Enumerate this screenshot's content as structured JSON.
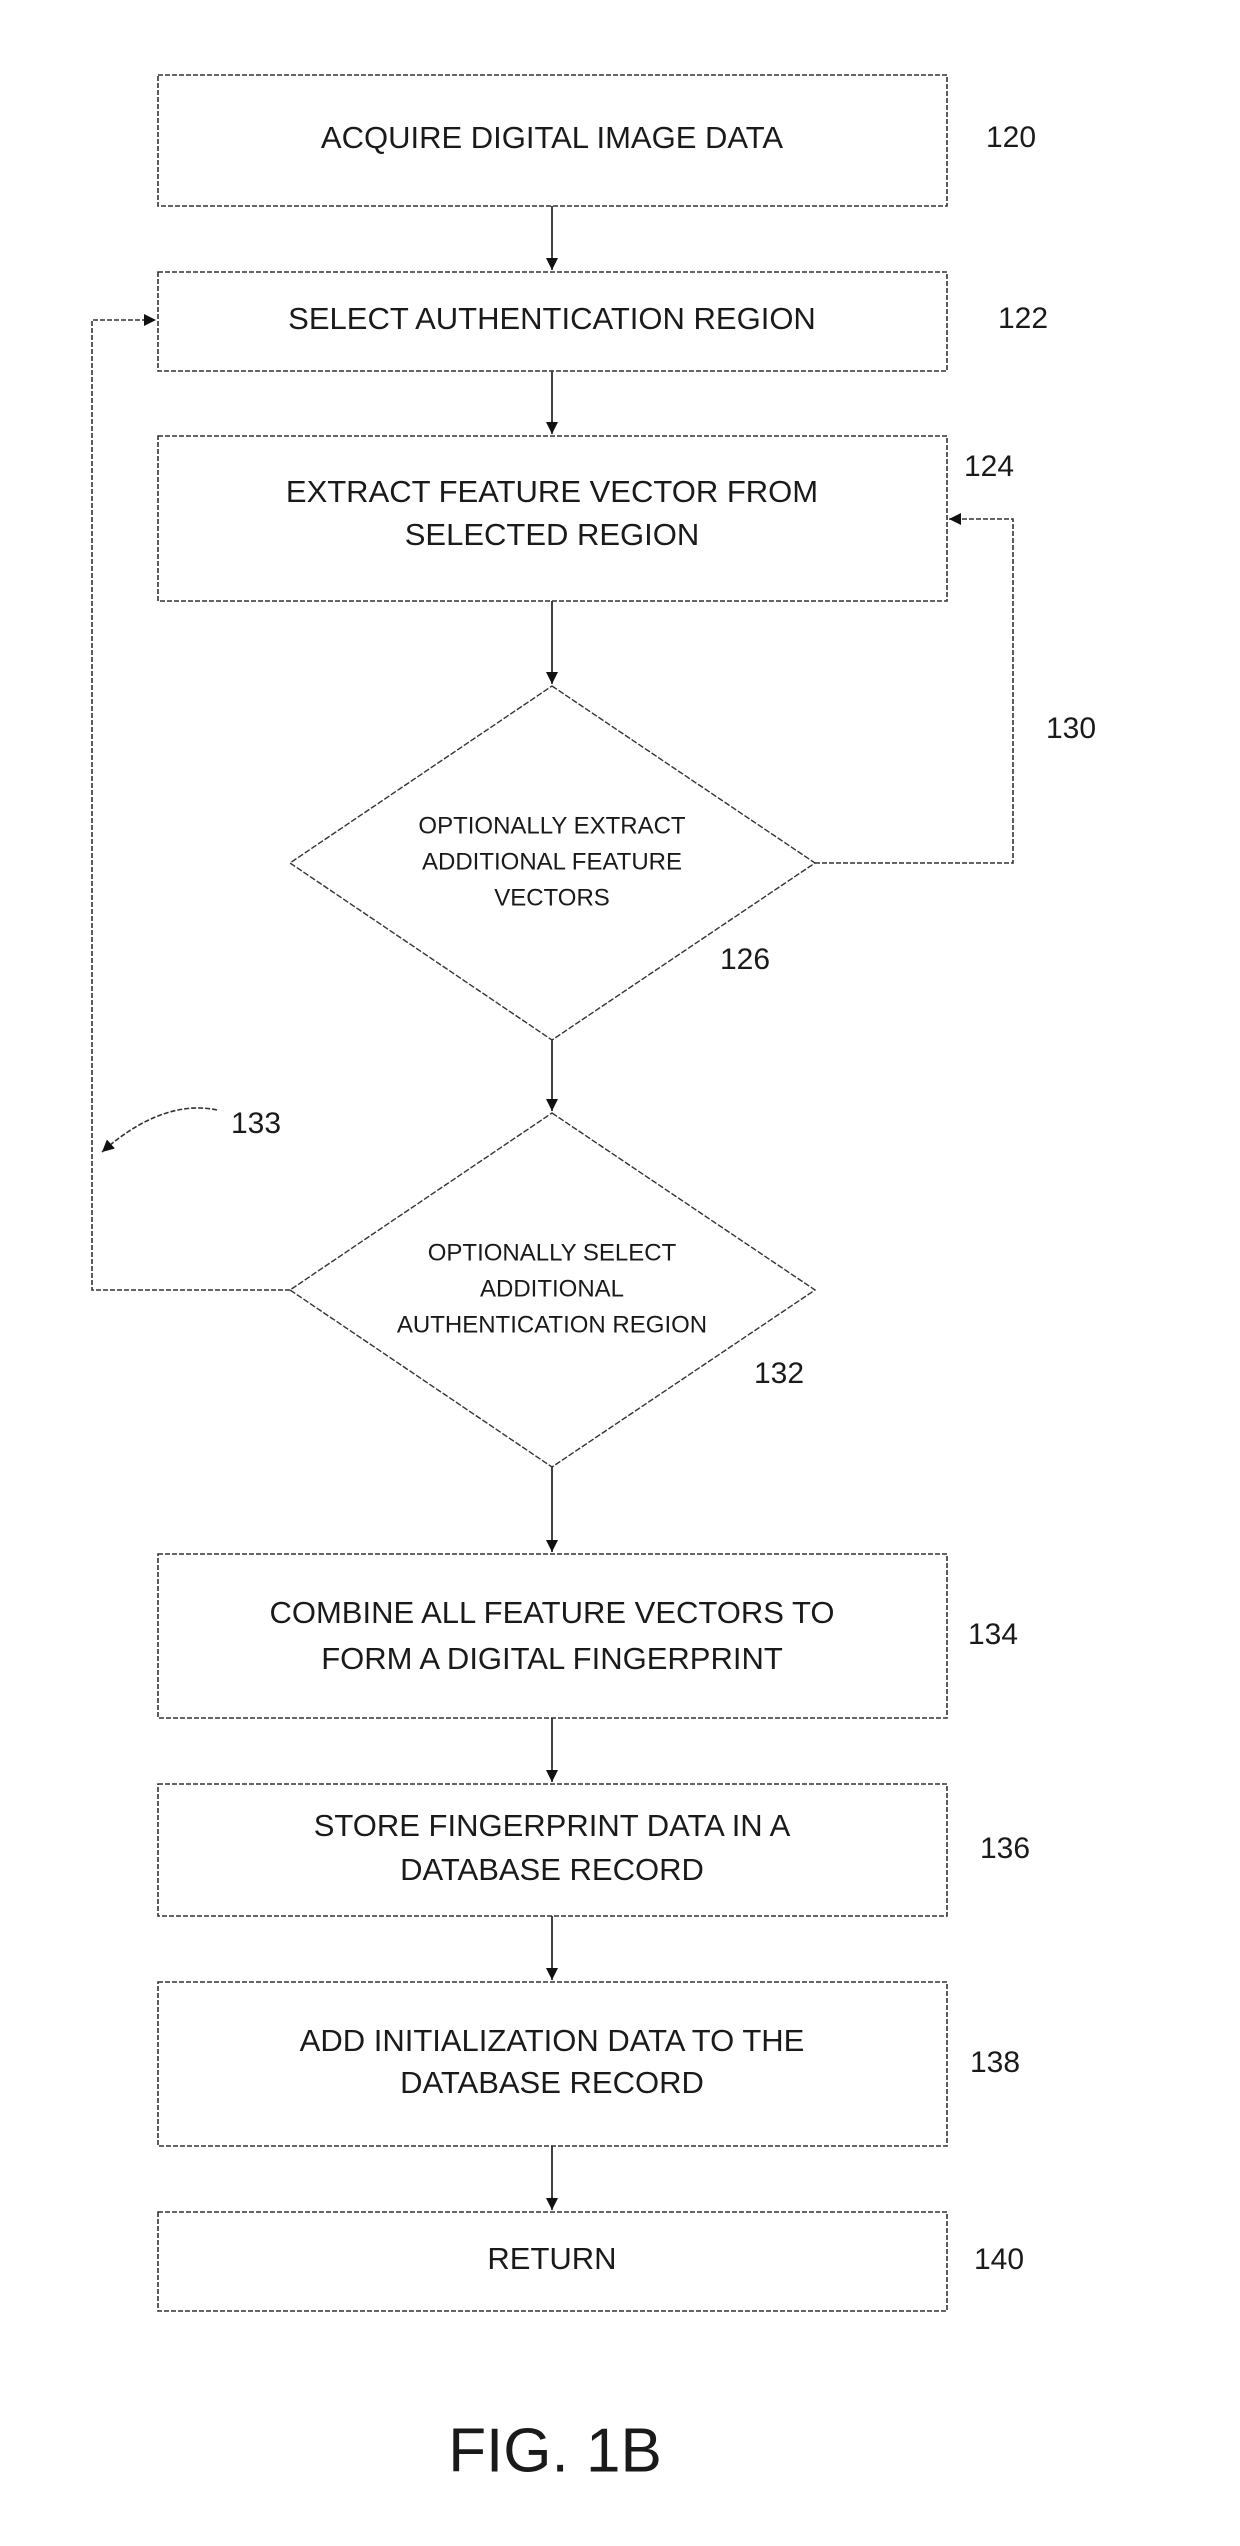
{
  "figure_label": "FIG. 1B",
  "steps": [
    {
      "id": "120",
      "type": "process",
      "lines": [
        "ACQUIRE DIGITAL IMAGE DATA"
      ]
    },
    {
      "id": "122",
      "type": "process",
      "lines": [
        "SELECT AUTHENTICATION REGION"
      ]
    },
    {
      "id": "124",
      "type": "process",
      "lines": [
        "EXTRACT FEATURE VECTOR FROM",
        "SELECTED REGION"
      ]
    },
    {
      "id": "126",
      "type": "decision",
      "lines": [
        "OPTIONALLY EXTRACT",
        "ADDITIONAL FEATURE",
        "VECTORS"
      ]
    },
    {
      "id": "132",
      "type": "decision",
      "lines": [
        "OPTIONALLY SELECT",
        "ADDITIONAL",
        "AUTHENTICATION REGION"
      ]
    },
    {
      "id": "134",
      "type": "process",
      "lines": [
        "COMBINE ALL FEATURE VECTORS TO",
        "FORM A DIGITAL FINGERPRINT"
      ]
    },
    {
      "id": "136",
      "type": "process",
      "lines": [
        "STORE FINGERPRINT DATA IN A",
        "DATABASE RECORD"
      ]
    },
    {
      "id": "138",
      "type": "process",
      "lines": [
        "ADD INITIALIZATION DATA TO THE",
        "DATABASE RECORD"
      ]
    },
    {
      "id": "140",
      "type": "process",
      "lines": [
        "RETURN"
      ]
    }
  ],
  "loops": [
    {
      "id": "130",
      "from": "126",
      "to": "124"
    },
    {
      "id": "133",
      "from": "132",
      "to": "122"
    }
  ],
  "ref_labels": {
    "r120": "120",
    "r122": "122",
    "r124": "124",
    "r126": "126",
    "r130": "130",
    "r132": "132",
    "r133": "133",
    "r134": "134",
    "r136": "136",
    "r138": "138",
    "r140": "140"
  }
}
